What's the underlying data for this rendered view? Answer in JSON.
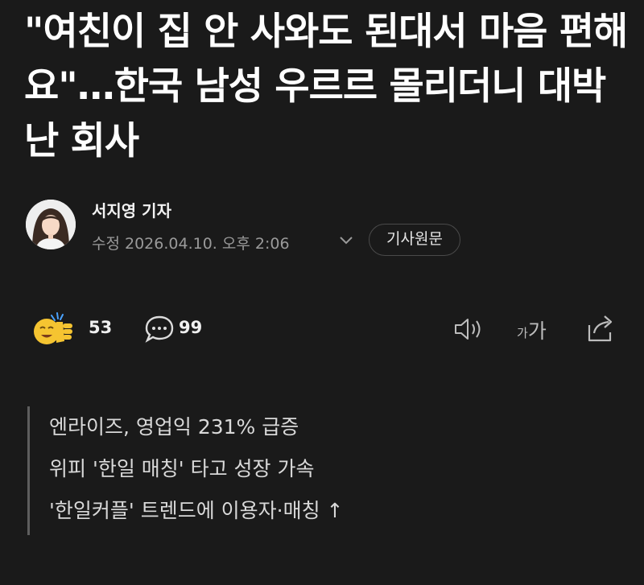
{
  "article": {
    "headline": "\"여친이 집 안 사와도 된대서 마음 편해요\"…한국 남성 우르르 몰리더니 대박 난 회사"
  },
  "byline": {
    "reporter": "서지영 기자",
    "timestamp": "수정 2026.04.10. 오후 2:06",
    "original_button": "기사원문"
  },
  "reactions": {
    "likes": "53",
    "comments": "99",
    "font_size_label_small": "가",
    "font_size_label_large": "가"
  },
  "summary": {
    "lines": [
      "엔라이즈, 영업익 231% 급증",
      "위피 '한일 매칭' 타고 성장 가속",
      "'한일커플' 트렌드에 이용자·매칭 ↑"
    ]
  },
  "icons": {
    "like": "clapping-emoji-icon",
    "comment": "speech-bubble-icon",
    "listen": "speaker-icon",
    "font_size": "text-size-icon",
    "share": "share-icon",
    "expand": "chevron-down-icon"
  },
  "colors": {
    "background": "#1a1a1a",
    "text_primary": "#ffffff",
    "text_secondary": "#9a9a9a",
    "summary_text": "#d9d9d9",
    "emoji_yellow": "#f5c431"
  }
}
